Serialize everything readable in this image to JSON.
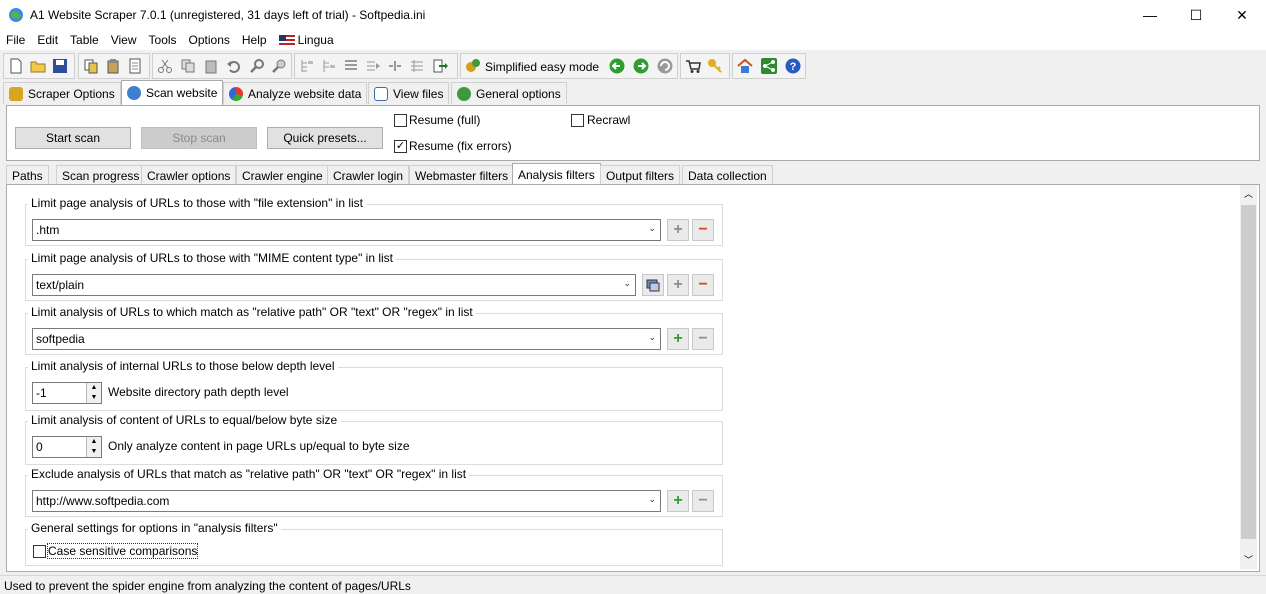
{
  "window": {
    "title": "A1 Website Scraper 7.0.1 (unregistered, 31 days left of trial) - Softpedia.ini",
    "minimize": "—",
    "maximize": "☐",
    "close": "✕"
  },
  "menu": [
    "File",
    "Edit",
    "Table",
    "View",
    "Tools",
    "Options",
    "Help",
    "Lingua"
  ],
  "toolbar": {
    "simplified_label": "Simplified easy mode"
  },
  "main_tabs": [
    "Scraper Options",
    "Scan website",
    "Analyze website data",
    "View files",
    "General options"
  ],
  "scan_panel": {
    "start_scan": "Start scan",
    "stop_scan": "Stop scan",
    "quick_presets": "Quick presets...",
    "resume_full": "Resume (full)",
    "resume_fix": "Resume (fix errors)",
    "resume_fix_checked": "✓",
    "recrawl": "Recrawl"
  },
  "sub_tabs": [
    "Paths",
    "Scan progress",
    "Crawler options",
    "Crawler engine",
    "Crawler login",
    "Webmaster filters",
    "Analysis filters",
    "Output filters",
    "Data collection"
  ],
  "filters": {
    "file_ext": {
      "title": "Limit page analysis of URLs to those with \"file extension\" in list",
      "value": ".htm"
    },
    "mime": {
      "title": "Limit page analysis of URLs to those with \"MIME content type\" in list",
      "value": "text/plain"
    },
    "relpath": {
      "title": "Limit analysis of URLs to which match as \"relative path\" OR \"text\" OR \"regex\" in list",
      "value": "softpedia"
    },
    "depth": {
      "title": "Limit analysis of internal URLs to those below depth level",
      "value": "-1",
      "label": "Website directory path depth level"
    },
    "bytes": {
      "title": "Limit analysis of content of URLs to equal/below byte size",
      "value": "0",
      "label": "Only analyze content in page URLs up/equal to byte size"
    },
    "exclude": {
      "title": "Exclude analysis of URLs that match as \"relative path\" OR \"text\" OR \"regex\" in list",
      "value": "http://www.softpedia.com"
    },
    "general": {
      "title": "General settings for options in \"analysis filters\"",
      "case_label": "Case sensitive comparisons"
    }
  },
  "status": "Used to prevent the spider engine from analyzing the content of pages/URLs",
  "buttons": {
    "plus": "+",
    "minus": "−",
    "arrow": "⌄",
    "spin_up": "▲",
    "spin_down": "▼"
  },
  "colors": {
    "plus_green": "#2e9e2e",
    "minus_red": "#d24a1e",
    "minus_gray": "#8f8f8f"
  }
}
